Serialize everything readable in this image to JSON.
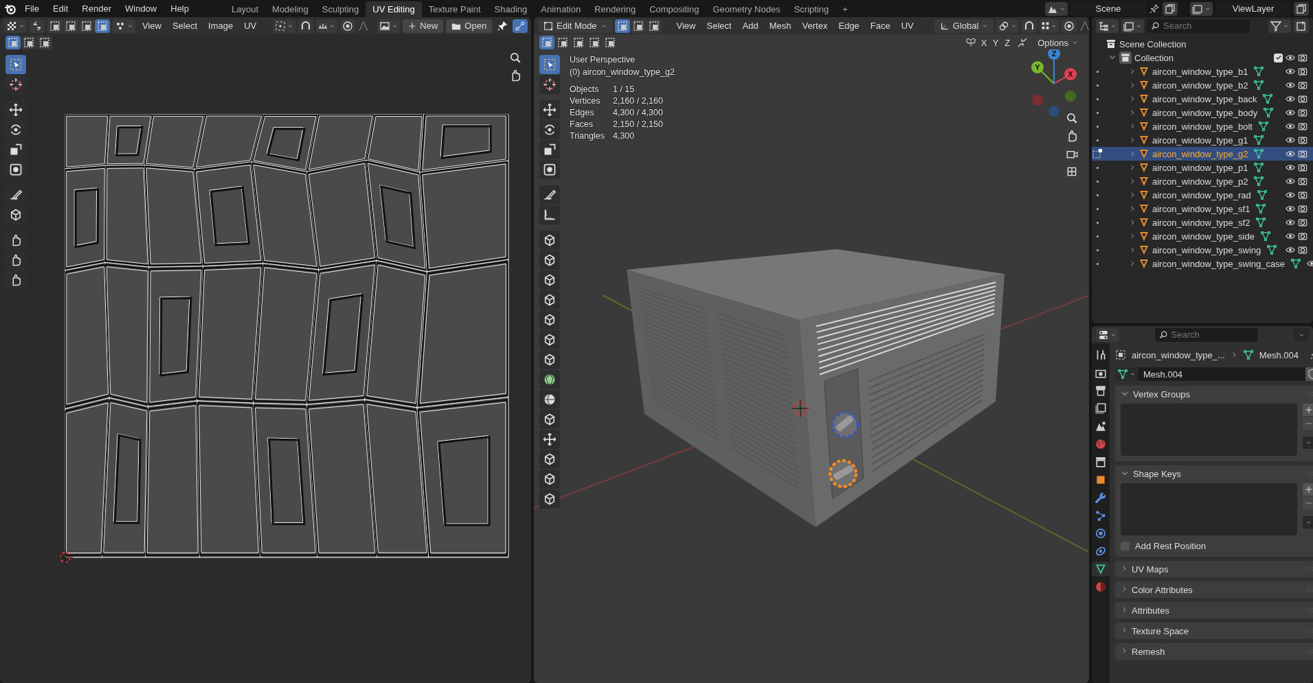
{
  "topbar": {
    "menus": [
      "File",
      "Edit",
      "Render",
      "Window",
      "Help"
    ],
    "workspaces": [
      {
        "label": "Layout",
        "selected": false
      },
      {
        "label": "Modeling",
        "selected": false
      },
      {
        "label": "Sculpting",
        "selected": false
      },
      {
        "label": "UV Editing",
        "selected": true
      },
      {
        "label": "Texture Paint",
        "selected": false
      },
      {
        "label": "Shading",
        "selected": false
      },
      {
        "label": "Animation",
        "selected": false
      },
      {
        "label": "Rendering",
        "selected": false
      },
      {
        "label": "Compositing",
        "selected": false
      },
      {
        "label": "Geometry Nodes",
        "selected": false
      },
      {
        "label": "Scripting",
        "selected": false
      }
    ],
    "add_workspace": "+",
    "scene": "Scene",
    "view_layer": "ViewLayer"
  },
  "uv_editor": {
    "select_modes": [
      {
        "selected": false
      },
      {
        "selected": false
      },
      {
        "selected": false
      },
      {
        "selected": true
      }
    ],
    "menus": [
      "View",
      "Select",
      "Image",
      "UV"
    ],
    "new_button": "New",
    "open_button": "Open",
    "box_modes": [
      {
        "selected": true
      },
      {
        "selected": false
      },
      {
        "selected": false
      }
    ],
    "tools": [
      {
        "selected": true
      },
      {
        "selected": false
      },
      {
        "selected": false
      },
      {
        "selected": false
      },
      {
        "selected": false
      },
      {
        "selected": false
      },
      {
        "selected": false
      },
      {
        "selected": false
      },
      {
        "selected": false
      },
      {
        "selected": false
      },
      {
        "selected": false
      }
    ]
  },
  "viewport": {
    "mode": "Edit Mode",
    "select_modes": [
      {
        "selected": true
      },
      {
        "selected": false
      },
      {
        "selected": false
      }
    ],
    "menus": [
      "View",
      "Select",
      "Add",
      "Mesh",
      "Vertex",
      "Edge",
      "Face",
      "UV"
    ],
    "orientation": "Global",
    "box_modes": [
      {
        "selected": true
      },
      {
        "selected": false
      },
      {
        "selected": false
      },
      {
        "selected": false
      },
      {
        "selected": false
      }
    ],
    "mirror_axes": [
      "X",
      "Y",
      "Z"
    ],
    "options": "Options",
    "overlay": {
      "view": "User Perspective",
      "object": "(0) aircon_window_type_g2",
      "stats": [
        {
          "label": "Objects",
          "value": "1 / 15"
        },
        {
          "label": "Vertices",
          "value": "2,160 / 2,160"
        },
        {
          "label": "Edges",
          "value": "4,300 / 4,300"
        },
        {
          "label": "Faces",
          "value": "2,150 / 2,150"
        },
        {
          "label": "Triangles",
          "value": "4,300"
        }
      ]
    },
    "gizmo_axes": [
      "X",
      "Y",
      "Z"
    ],
    "tools": [
      {
        "selected": true
      },
      {
        "selected": false
      },
      {
        "selected": false
      },
      {
        "selected": false
      },
      {
        "selected": false
      },
      {
        "selected": false
      },
      {
        "selected": false
      },
      {
        "selected": false
      },
      {
        "selected": false
      },
      {
        "selected": false
      },
      {
        "selected": false
      },
      {
        "selected": false
      },
      {
        "selected": false
      },
      {
        "selected": false
      },
      {
        "selected": false
      },
      {
        "selected": false
      },
      {
        "selected": false
      },
      {
        "selected": false
      },
      {
        "selected": false
      },
      {
        "selected": false
      },
      {
        "selected": false
      },
      {
        "selected": false
      }
    ]
  },
  "outliner": {
    "search": {
      "placeholder": "Search"
    },
    "scene_collection": "Scene Collection",
    "collection": {
      "label": "Collection",
      "expanded": true,
      "checked": true
    },
    "items": [
      {
        "name": "aircon_window_type_b1",
        "selected": false
      },
      {
        "name": "aircon_window_type_b2",
        "selected": false
      },
      {
        "name": "aircon_window_type_back",
        "selected": false
      },
      {
        "name": "aircon_window_type_body",
        "selected": false
      },
      {
        "name": "aircon_window_type_bolt",
        "selected": false
      },
      {
        "name": "aircon_window_type_g1",
        "selected": false
      },
      {
        "name": "aircon_window_type_g2",
        "selected": true
      },
      {
        "name": "aircon_window_type_p1",
        "selected": false
      },
      {
        "name": "aircon_window_type_p2",
        "selected": false
      },
      {
        "name": "aircon_window_type_rad",
        "selected": false
      },
      {
        "name": "aircon_window_type_sf1",
        "selected": false
      },
      {
        "name": "aircon_window_type_sf2",
        "selected": false
      },
      {
        "name": "aircon_window_type_side",
        "selected": false
      },
      {
        "name": "aircon_window_type_swing",
        "selected": false
      },
      {
        "name": "aircon_window_type_swing_case",
        "selected": false
      }
    ]
  },
  "properties": {
    "search": {
      "placeholder": "Search"
    },
    "tabs": [
      {
        "selected": false
      },
      {
        "selected": false
      },
      {
        "selected": false
      },
      {
        "selected": false
      },
      {
        "selected": false
      },
      {
        "selected": false
      },
      {
        "selected": false
      },
      {
        "selected": false
      },
      {
        "selected": false
      },
      {
        "selected": false
      },
      {
        "selected": false
      },
      {
        "selected": false
      },
      {
        "selected": true
      },
      {
        "selected": false
      }
    ],
    "breadcrumb": {
      "object": "aircon_window_type_...",
      "data": "Mesh.004"
    },
    "mesh_name": "Mesh.004",
    "panels": [
      {
        "title": "Vertex Groups",
        "expanded": true
      },
      {
        "title": "Shape Keys",
        "expanded": true,
        "option": {
          "label": "Add Rest Position",
          "checked": false
        }
      },
      {
        "title": "UV Maps",
        "expanded": false
      },
      {
        "title": "Color Attributes",
        "expanded": false
      },
      {
        "title": "Attributes",
        "expanded": false
      },
      {
        "title": "Texture Space",
        "expanded": false
      },
      {
        "title": "Remesh",
        "expanded": false
      }
    ]
  }
}
